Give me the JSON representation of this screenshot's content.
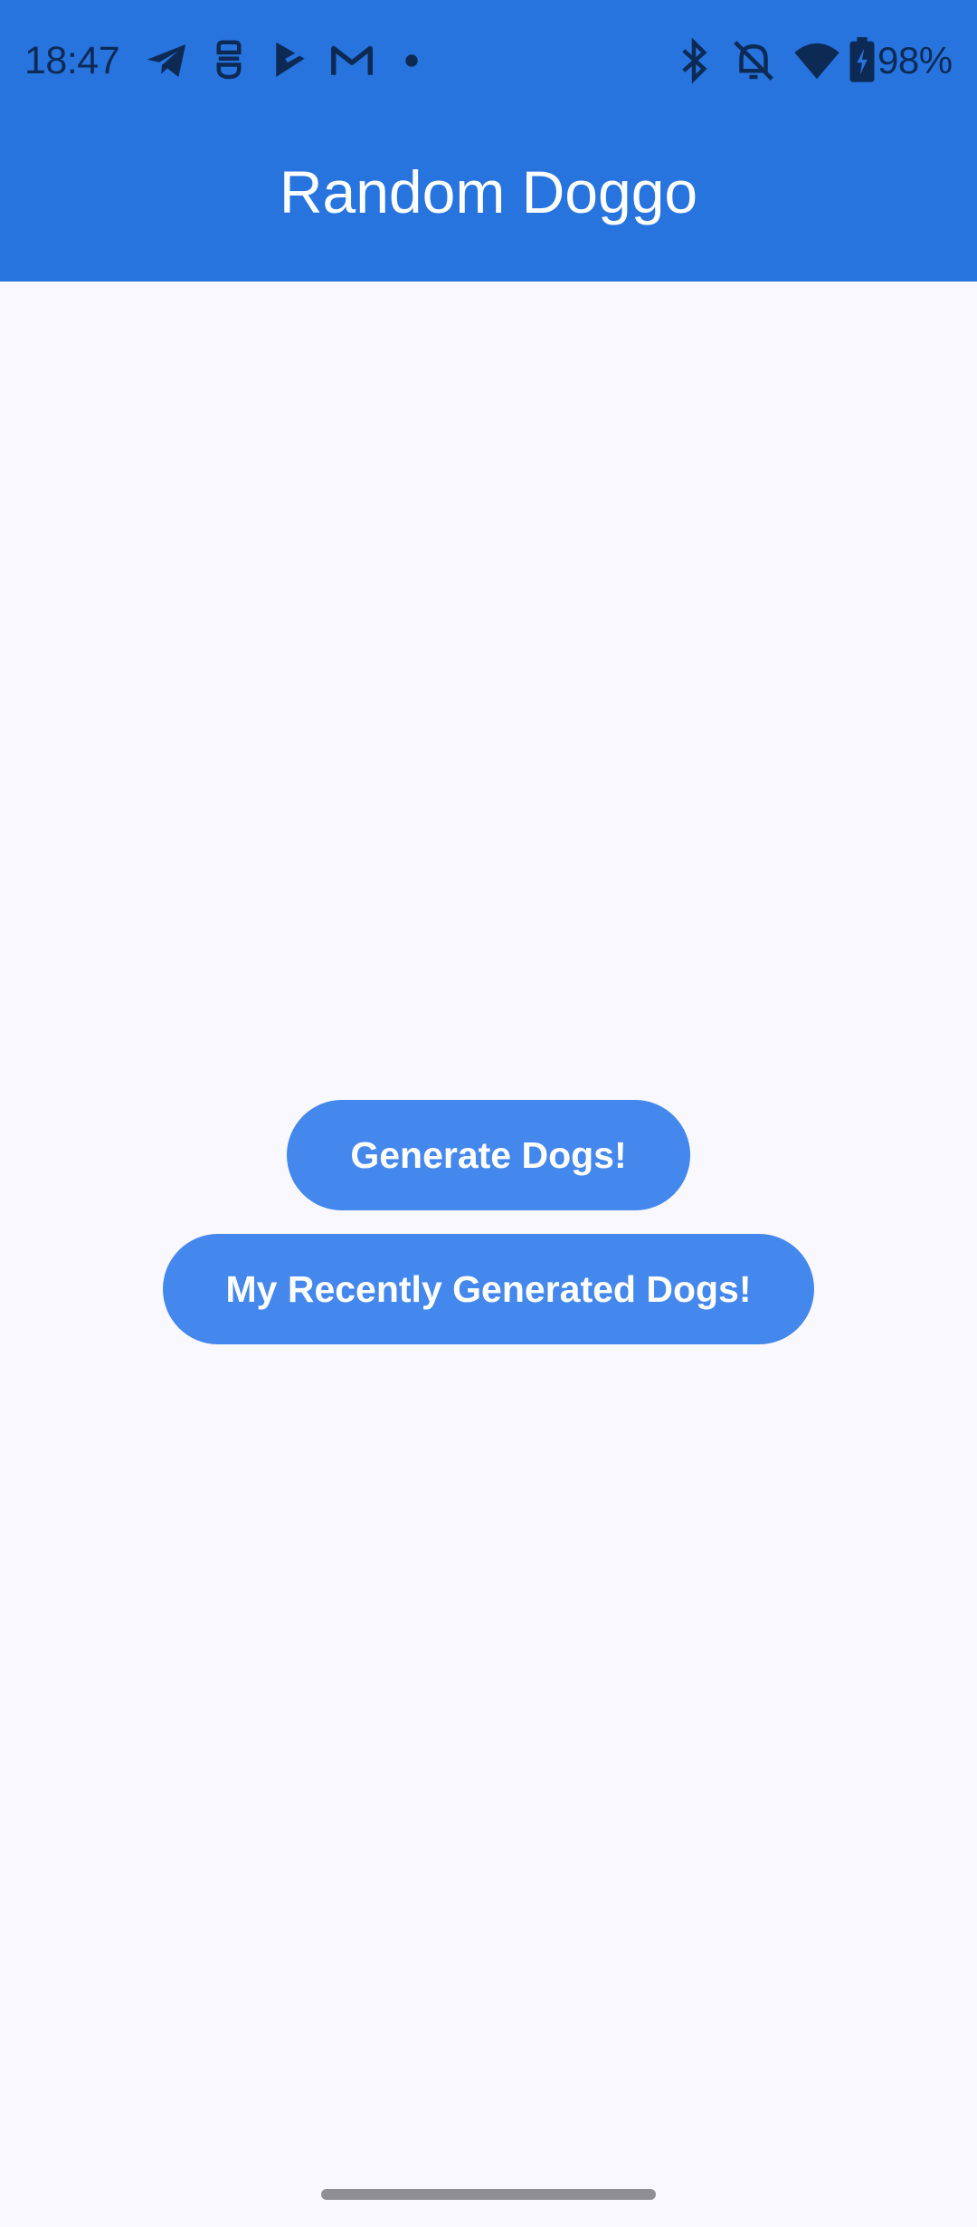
{
  "status_bar": {
    "time": "18:47",
    "battery_percent": "98%",
    "notification_icons": [
      "telegram-icon",
      "bug-icon",
      "play-icon",
      "gmail-icon",
      "dot-icon"
    ],
    "system_icons": [
      "bluetooth-icon",
      "bell-off-icon",
      "wifi-icon",
      "battery-charging-icon"
    ],
    "icon_color": "#0d2a55"
  },
  "app_bar": {
    "title": "Random Doggo",
    "color": "#2774de"
  },
  "main": {
    "generate_button_label": "Generate Dogs!",
    "recent_button_label": "My Recently Generated Dogs!",
    "button_color": "#4487ed",
    "background_color": "#f8f8fe"
  }
}
